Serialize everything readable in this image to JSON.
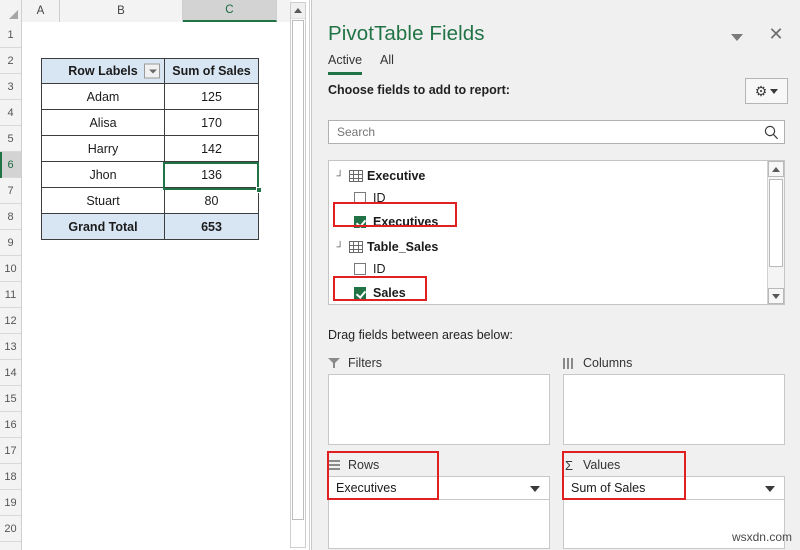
{
  "sheet": {
    "columns": [
      "A",
      "B",
      "C"
    ],
    "selected_column": "C",
    "rows": [
      "1",
      "2",
      "3",
      "4",
      "5",
      "6",
      "7",
      "8",
      "9",
      "10",
      "11",
      "12",
      "13",
      "14",
      "15",
      "16",
      "17",
      "18",
      "19",
      "20"
    ],
    "selected_row": "6",
    "selected_cell": "C6",
    "pivot_table": {
      "headers": [
        "Row Labels",
        "Sum of Sales"
      ],
      "rows": [
        {
          "label": "Adam",
          "value": "125"
        },
        {
          "label": "Alisa",
          "value": "170"
        },
        {
          "label": "Harry",
          "value": "142"
        },
        {
          "label": "Jhon",
          "value": "136"
        },
        {
          "label": "Stuart",
          "value": "80"
        }
      ],
      "total": {
        "label": "Grand Total",
        "value": "653"
      }
    }
  },
  "panel": {
    "title": "PivotTable Fields",
    "close_label": "✕",
    "tabs": [
      {
        "label": "Active",
        "active": true
      },
      {
        "label": "All",
        "active": false
      }
    ],
    "choose_label": "Choose fields to add to report:",
    "gear_glyph": "⚙",
    "search": {
      "placeholder": "Search",
      "value": ""
    },
    "field_groups": [
      {
        "table": "Executive",
        "fields": [
          {
            "label": "ID",
            "checked": false,
            "highlighted": false
          },
          {
            "label": "Executives",
            "checked": true,
            "highlighted": true
          }
        ]
      },
      {
        "table": "Table_Sales",
        "fields": [
          {
            "label": "ID",
            "checked": false,
            "highlighted": false
          },
          {
            "label": "Sales",
            "checked": true,
            "highlighted": true
          }
        ]
      }
    ],
    "drag_label": "Drag fields between areas below:",
    "zones": [
      {
        "name": "Filters",
        "icon": "funnel-icon",
        "items": [],
        "highlighted": false
      },
      {
        "name": "Columns",
        "icon": "columns-icon",
        "items": [],
        "highlighted": false
      },
      {
        "name": "Rows",
        "icon": "rows-icon",
        "items": [
          "Executives"
        ],
        "highlighted": true
      },
      {
        "name": "Values",
        "icon": "sigma-icon",
        "items": [
          "Sum of Sales"
        ],
        "highlighted": true
      }
    ]
  },
  "watermark": "wsxdn.com",
  "colors": {
    "excel_green": "#217346",
    "header_fill": "#d8e6f3",
    "highlight_red": "#e02020",
    "panel_bg": "#f0f0f0"
  }
}
